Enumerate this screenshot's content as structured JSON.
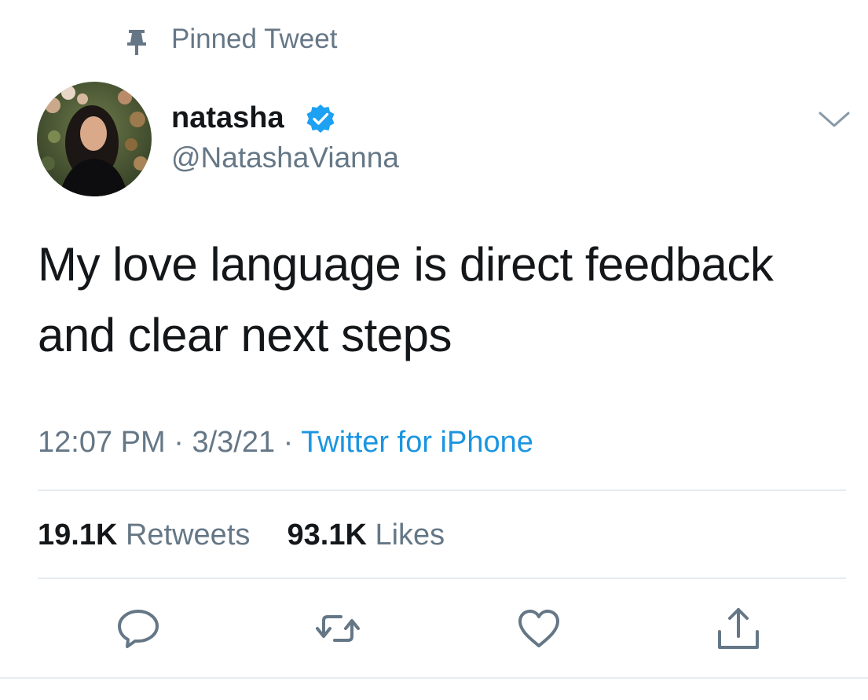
{
  "pinned": {
    "label": "Pinned Tweet",
    "icon": "pin-icon"
  },
  "author": {
    "display_name": "natasha",
    "handle": "@NatashaVianna",
    "verified": true,
    "verified_color": "#1da1f2"
  },
  "tweet": {
    "text": "My love language is direct feedback and clear next steps",
    "time": "12:07 PM",
    "date": "3/3/21",
    "separator": "·",
    "source": "Twitter for iPhone"
  },
  "stats": {
    "retweets_count": "19.1K",
    "retweets_label": "Retweets",
    "likes_count": "93.1K",
    "likes_label": "Likes"
  },
  "actions": [
    {
      "name": "reply",
      "icon": "reply-icon"
    },
    {
      "name": "retweet",
      "icon": "retweet-icon"
    },
    {
      "name": "like",
      "icon": "heart-icon"
    },
    {
      "name": "share",
      "icon": "share-icon"
    }
  ],
  "colors": {
    "text": "#14171a",
    "secondary": "#657786",
    "link": "#1b95e0",
    "icon": "#657786",
    "divider": "#e6ecf0"
  }
}
